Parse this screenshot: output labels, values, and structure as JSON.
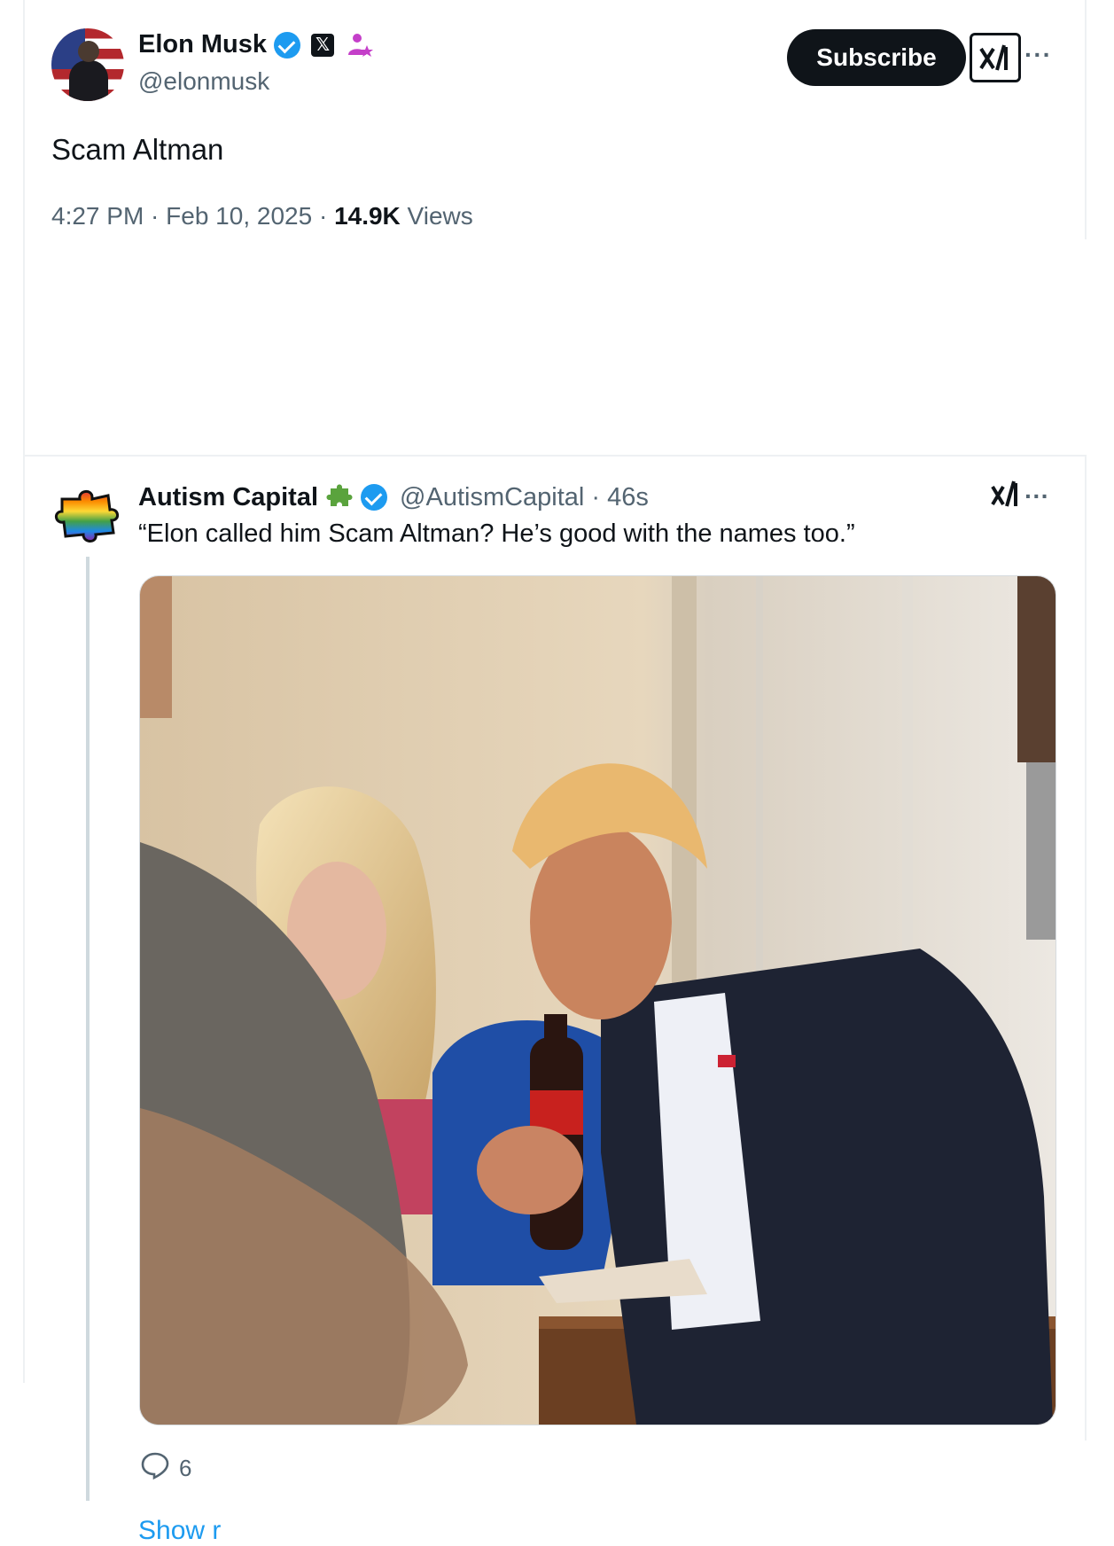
{
  "main_tweet": {
    "name": "Elon Musk",
    "handle": "@elonmusk",
    "subscribe_label": "Subscribe",
    "grok_label": "x",
    "more_label": "···",
    "text": "Scam Altman",
    "time": "4:27 PM · Feb 10, 2025 · ",
    "views_count": "14.9K",
    "views_label": " Views",
    "x_badge": "𝕏"
  },
  "quoted_reply": {
    "name": "Autism Capital",
    "handle": "@AutismCapital · 46s",
    "text": "“Elon called him Scam Altman? He’s good with the names too.”",
    "grok_label": "x",
    "more_label": "···",
    "reply_count": "6",
    "show_more": "Show r"
  },
  "colors": {
    "accent": "#1d9bf0",
    "text_primary": "#0f1419",
    "text_secondary": "#536471",
    "button_dark": "#0f1419"
  },
  "icons": {
    "verified": "verified-badge-icon",
    "x_logo": "x-logo-icon",
    "affiliate": "person-star-icon",
    "puzzle": "puzzle-piece-icon",
    "reply": "reply-bubble-icon",
    "grok": "grok-icon",
    "more": "more-icon"
  }
}
